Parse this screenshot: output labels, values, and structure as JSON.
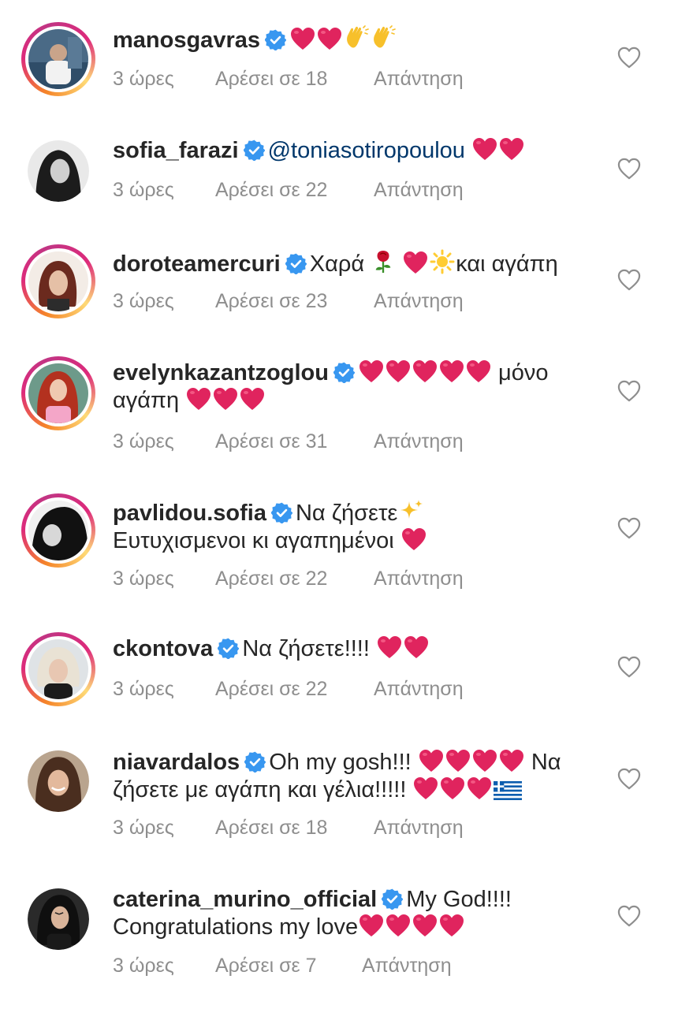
{
  "colors": {
    "text": "#262626",
    "secondary": "#8e8e8e",
    "verified": "#3897f0",
    "heart": "#e0245e",
    "story_ring": [
      "#f58529",
      "#dd2a7b",
      "#feda77"
    ]
  },
  "comments": [
    {
      "username": "manosgavras",
      "text_parts": [],
      "time": "3 ώρες",
      "likes": "Αρέσει σε 18",
      "reply": "Απάντηση"
    },
    {
      "username": "sofia_farazi",
      "mention": "@toniasotiropoulou",
      "time": "3 ώρες",
      "likes": "Αρέσει σε 22",
      "reply": "Απάντηση"
    },
    {
      "username": "doroteamercuri",
      "text_a": "Χαρά",
      "text_b": "και αγάπη",
      "time": "3 ώρες",
      "likes": "Αρέσει σε 23",
      "reply": "Απάντηση"
    },
    {
      "username": "evelynkazantzoglou",
      "text_a": "μόνο",
      "text_b": "αγάπη",
      "time": "3 ώρες",
      "likes": "Αρέσει σε 31",
      "reply": "Απάντηση"
    },
    {
      "username": "pavlidou.sofia",
      "text_a": "Να ζήσετε",
      "text_b": "Ευτυχισμενοι κι αγαπημένοι",
      "time": "3 ώρες",
      "likes": "Αρέσει σε 22",
      "reply": "Απάντηση"
    },
    {
      "username": "ckontova",
      "text_a": "Να ζήσετε!!!!",
      "time": "3 ώρες",
      "likes": "Αρέσει σε 22",
      "reply": "Απάντηση"
    },
    {
      "username": "niavardalos",
      "text_a": "Oh my gosh!!!",
      "text_b": "Να",
      "text_c": "ζήσετε με αγάπη και γέλια!!!!!",
      "time": "3 ώρες",
      "likes": "Αρέσει σε 18",
      "reply": "Απάντηση"
    },
    {
      "username": "caterina_murino_official",
      "text_a": "My God!!!!",
      "text_b": "Congratulations my love",
      "time": "3 ώρες",
      "likes": "Αρέσει σε 7",
      "reply": "Απάντηση"
    }
  ]
}
